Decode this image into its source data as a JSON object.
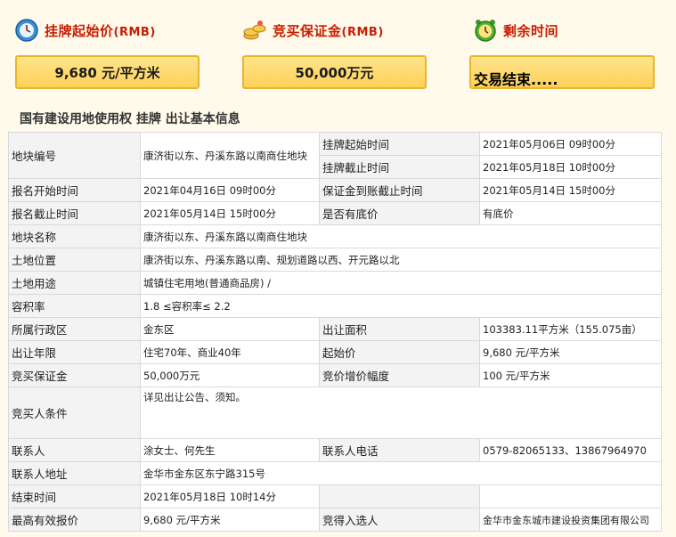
{
  "headers": {
    "start_price_label": "挂牌起始价",
    "start_price_unit": "(RMB)",
    "deposit_label": "竞买保证金",
    "deposit_unit": "(RMB)",
    "remaining_label": "剩余时间"
  },
  "boxes": {
    "start_price": "9,680 元/平方米",
    "deposit": "50,000万元",
    "remaining": "交易结束....."
  },
  "section_title": "国有建设用地使用权 挂牌 出让基本信息",
  "rows": {
    "plot_no_k": "地块编号",
    "plot_no_v": "康济街以东、丹溪东路以南商住地块",
    "list_start_k": "挂牌起始时间",
    "list_start_v": "2021年05月06日 09时00分",
    "list_end_k": "挂牌截止时间",
    "list_end_v": "2021年05月18日 10时00分",
    "reg_start_k": "报名开始时间",
    "reg_start_v": "2021年04月16日 09时00分",
    "deposit_deadline_k": "保证金到账截止时间",
    "deposit_deadline_v": "2021年05月14日 15时00分",
    "reg_end_k": "报名截止时间",
    "reg_end_v": "2021年05月14日 15时00分",
    "reserve_k": "是否有底价",
    "reserve_v": "有底价",
    "plot_name_k": "地块名称",
    "plot_name_v": "康济街以东、丹溪东路以南商住地块",
    "location_k": "土地位置",
    "location_v": "康济街以东、丹溪东路以南、规划道路以西、开元路以北",
    "use_k": "土地用途",
    "use_v": "城镇住宅用地(普通商品房) /",
    "far_k": "容积率",
    "far_v": "1.8 ≤容积率≤ 2.2",
    "district_k": "所属行政区",
    "district_v": "金东区",
    "area_k": "出让面积",
    "area_v": "103383.11平方米（155.075亩）",
    "term_k": "出让年限",
    "term_v": "住宅70年、商业40年",
    "start_price_k": "起始价",
    "start_price_v": "9,680 元/平方米",
    "bid_deposit_k": "竞买保证金",
    "bid_deposit_v": "50,000万元",
    "increment_k": "竞价增价幅度",
    "increment_v": "100 元/平方米",
    "conditions_k": "竞买人条件",
    "conditions_v": "详见出让公告、须知。",
    "contact_k": "联系人",
    "contact_v": "涂女士、何先生",
    "phone_k": "联系人电话",
    "phone_v": "0579-82065133、13867964970",
    "address_k": "联系人地址",
    "address_v": "金华市金东区东宁路315号",
    "end_time_k": "结束时间",
    "end_time_v": "2021年05月18日 10时14分",
    "highest_k": "最高有效报价",
    "highest_v": "9,680 元/平方米",
    "winner_k": "竞得入选人",
    "winner_v": "金华市金东城市建设投资集团有限公司"
  }
}
